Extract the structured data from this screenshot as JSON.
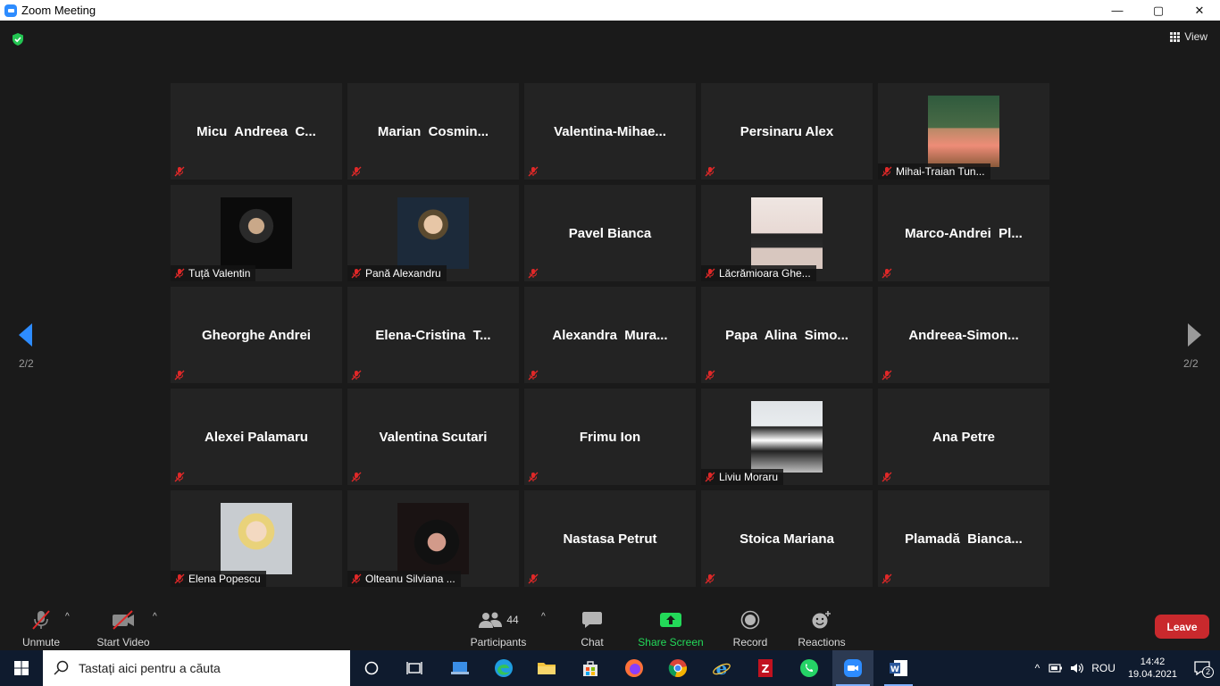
{
  "window": {
    "title": "Zoom Meeting",
    "minimize": "—",
    "maximize": "▢",
    "close": "✕"
  },
  "view_label": "View",
  "page_indicator": "2/2",
  "tiles": [
    {
      "name": "Micu  Andreea  C...",
      "photo": false
    },
    {
      "name": "Marian  Cosmin...",
      "photo": false
    },
    {
      "name": "Valentina-Mihae...",
      "photo": false
    },
    {
      "name": "Persinaru Alex",
      "photo": false
    },
    {
      "name": "Mihai-Traian Tun...",
      "photo": true
    },
    {
      "name": "Tuță Valentin",
      "photo": true
    },
    {
      "name": "Pană Alexandru",
      "photo": true
    },
    {
      "name": "Pavel Bianca",
      "photo": false
    },
    {
      "name": "Lăcrămioara Ghe...",
      "photo": true
    },
    {
      "name": "Marco-Andrei  Pl...",
      "photo": false
    },
    {
      "name": "Gheorghe Andrei",
      "photo": false
    },
    {
      "name": "Elena-Cristina  T...",
      "photo": false
    },
    {
      "name": "Alexandra  Mura...",
      "photo": false
    },
    {
      "name": "Papa  Alina  Simo...",
      "photo": false
    },
    {
      "name": "Andreea-Simon...",
      "photo": false
    },
    {
      "name": "Alexei Palamaru",
      "photo": false
    },
    {
      "name": "Valentina Scutari",
      "photo": false
    },
    {
      "name": "Frimu Ion",
      "photo": false
    },
    {
      "name": "Liviu Moraru",
      "photo": true
    },
    {
      "name": "Ana Petre",
      "photo": false
    },
    {
      "name": "Elena Popescu",
      "photo": true
    },
    {
      "name": "Olteanu Silviana ...",
      "photo": true
    },
    {
      "name": "Nastasa Petrut",
      "photo": false
    },
    {
      "name": "Stoica Mariana",
      "photo": false
    },
    {
      "name": "Plamadă  Bianca...",
      "photo": false
    }
  ],
  "toolbar": {
    "unmute": "Unmute",
    "start_video": "Start Video",
    "participants": "Participants",
    "participants_count": "44",
    "chat": "Chat",
    "share_screen": "Share Screen",
    "record": "Record",
    "reactions": "Reactions",
    "leave": "Leave"
  },
  "taskbar": {
    "search_placeholder": "Tastați aici pentru a căuta",
    "language": "ROU",
    "time": "14:42",
    "date": "19.04.2021",
    "notification_count": "2"
  },
  "colors": {
    "share_green": "#23d959",
    "leave_red": "#c9292d",
    "zoom_blue": "#2d8cff",
    "mute_red": "#e02828"
  }
}
